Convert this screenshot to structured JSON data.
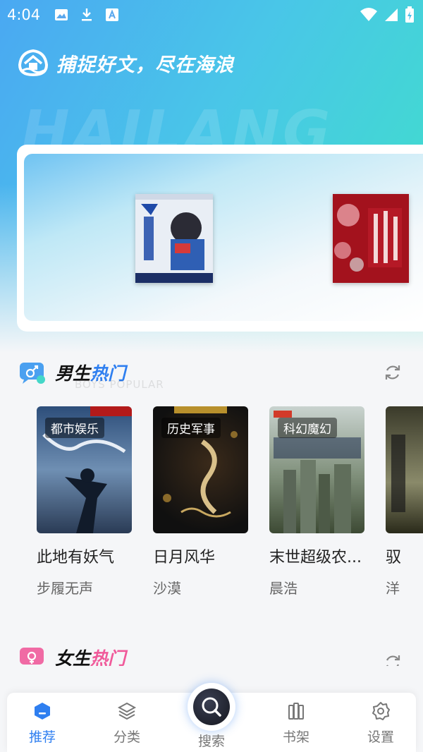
{
  "status_bar": {
    "time": "4:04"
  },
  "header": {
    "slogan": "捕捉好文，尽在海浪",
    "watermark": "HAILANG"
  },
  "section_male": {
    "title_a": "男生",
    "title_b": "热门",
    "subtitle": "BOYS POPULAR"
  },
  "books": [
    {
      "tag": "都市娱乐",
      "title": "此地有妖气",
      "author": "步履无声"
    },
    {
      "tag": "历史军事",
      "title": "日月风华",
      "author": "沙漠"
    },
    {
      "tag": "科幻魔幻",
      "title": "末世超级农...",
      "author": "晨浩"
    },
    {
      "tag": "",
      "title": "驭",
      "author": "洋"
    }
  ],
  "section_female": {
    "title_a": "女生",
    "title_b": "热门"
  },
  "tabs": {
    "recommend": "推荐",
    "category": "分类",
    "search": "搜索",
    "shelf": "书架",
    "settings": "设置"
  },
  "colors": {
    "accent": "#2f7ff0",
    "hero_start": "#4aa8f2",
    "hero_end": "#3fe1c8"
  }
}
